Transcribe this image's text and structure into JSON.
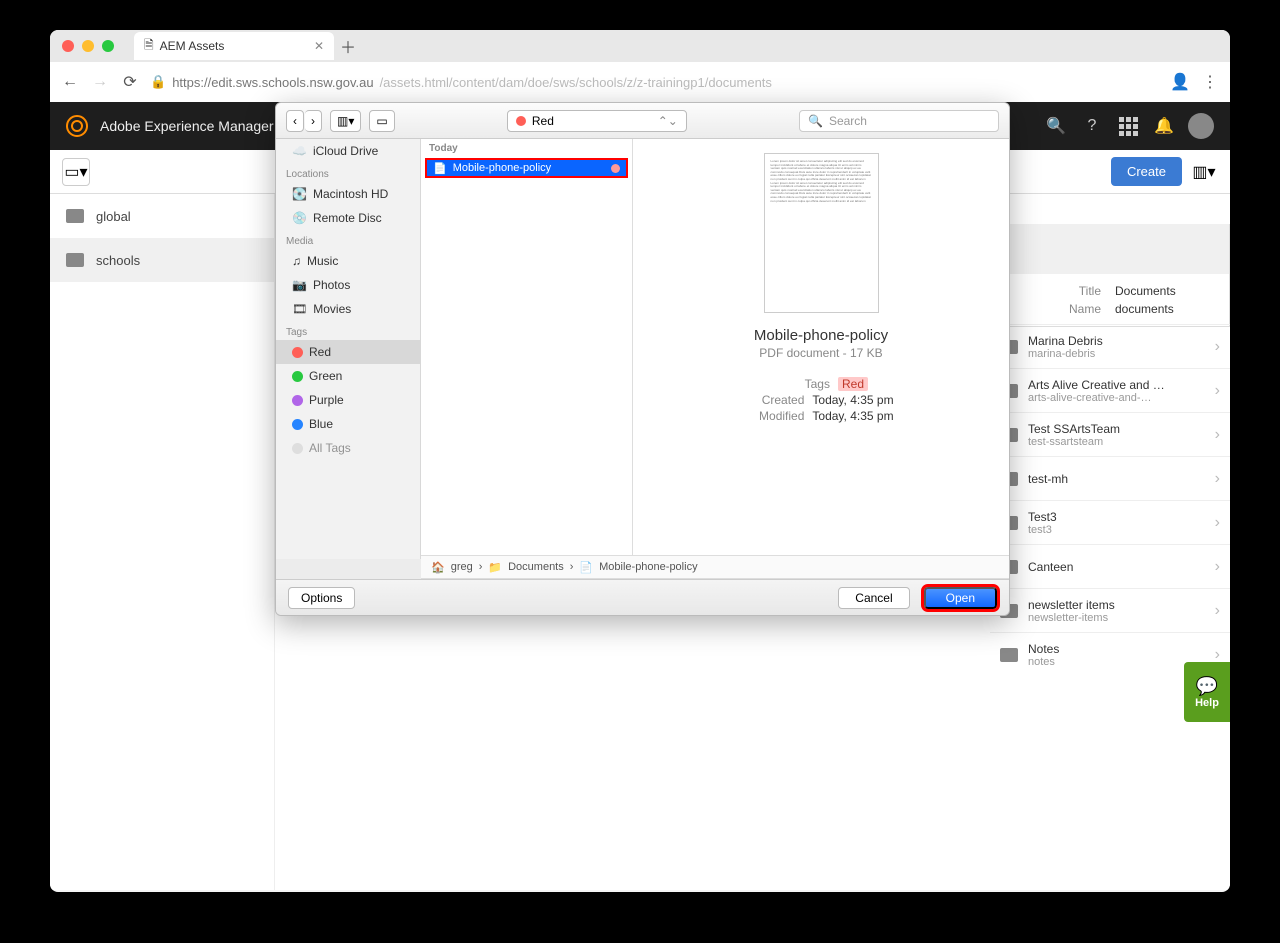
{
  "browser": {
    "tab_title": "AEM Assets",
    "url_secure_host": "https://edit.sws.schools.nsw.gov.au",
    "url_path": "/assets.html/content/dam/doe/sws/schools/z/z-trainingp1/documents"
  },
  "aem": {
    "product": "Adobe Experience Manager",
    "create": "Create",
    "sidebar": [
      {
        "label": "global"
      },
      {
        "label": "schools"
      }
    ],
    "detail": {
      "title_label": "Title",
      "title_value": "Documents",
      "name_label": "Name",
      "name_value": "documents"
    },
    "assets": [
      {
        "title": "Marina Debris",
        "sub": "marina-debris"
      },
      {
        "title": "Arts Alive Creative and …",
        "sub": "arts-alive-creative-and-…"
      },
      {
        "title": "Test SSArtsTeam",
        "sub": "test-ssartsteam"
      },
      {
        "title": "test-mh",
        "sub": ""
      },
      {
        "title": "Test3",
        "sub": "test3"
      },
      {
        "title": "Canteen",
        "sub": ""
      },
      {
        "title": "newsletter items",
        "sub": "newsletter-items"
      },
      {
        "title": "Notes",
        "sub": "notes"
      }
    ],
    "help": "Help"
  },
  "dialog": {
    "path_label": "Red",
    "search_placeholder": "Search",
    "sidebar": {
      "icloud": "iCloud Drive",
      "locations_head": "Locations",
      "macintosh": "Macintosh HD",
      "remote": "Remote Disc",
      "media_head": "Media",
      "music": "Music",
      "photos": "Photos",
      "movies": "Movies",
      "tags_head": "Tags",
      "tags": [
        {
          "label": "Red",
          "color": "#ff5f57",
          "selected": true
        },
        {
          "label": "Green",
          "color": "#28c940"
        },
        {
          "label": "Purple",
          "color": "#b065e8"
        },
        {
          "label": "Blue",
          "color": "#2684ff"
        },
        {
          "label": "All Tags",
          "color": "#cccccc"
        }
      ]
    },
    "column_head": "Today",
    "file": "Mobile-phone-policy",
    "preview": {
      "title": "Mobile-phone-policy",
      "subtitle": "PDF document - 17 KB",
      "tags_label": "Tags",
      "tags_value": "Red",
      "created_label": "Created",
      "created_value": "Today, 4:35 pm",
      "modified_label": "Modified",
      "modified_value": "Today, 4:35 pm"
    },
    "breadcrumb": [
      "greg",
      "Documents",
      "Mobile-phone-policy"
    ],
    "options": "Options",
    "cancel": "Cancel",
    "open": "Open"
  }
}
